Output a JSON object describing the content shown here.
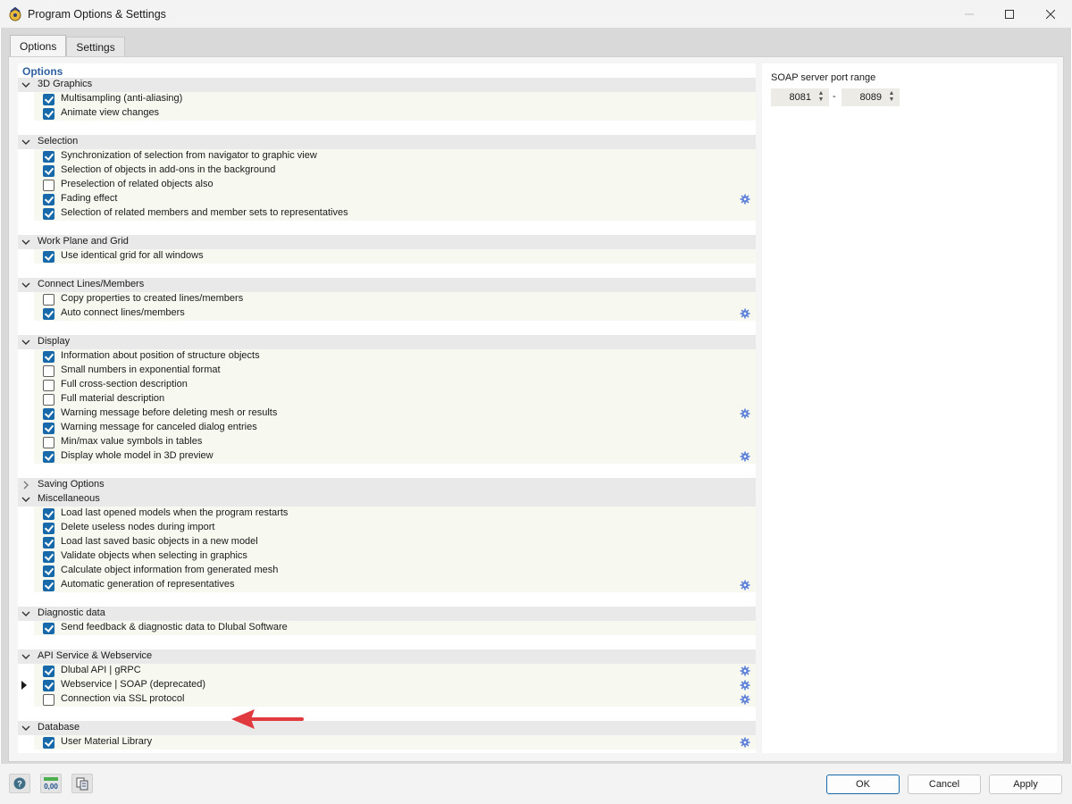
{
  "window": {
    "title": "Program Options & Settings"
  },
  "tabs": [
    {
      "label": "Options",
      "active": true
    },
    {
      "label": "Settings",
      "active": false
    }
  ],
  "options_header": "Options",
  "sections": [
    {
      "title": "3D Graphics",
      "expanded": true,
      "items": [
        {
          "label": "Multisampling (anti-aliasing)",
          "checked": true,
          "gear": false
        },
        {
          "label": "Animate view changes",
          "checked": true,
          "gear": false
        }
      ]
    },
    {
      "title": "Selection",
      "expanded": true,
      "items": [
        {
          "label": "Synchronization of selection from navigator to graphic view",
          "checked": true,
          "gear": false
        },
        {
          "label": "Selection of objects in add-ons in the background",
          "checked": true,
          "gear": false
        },
        {
          "label": "Preselection of related objects also",
          "checked": false,
          "gear": false
        },
        {
          "label": "Fading effect",
          "checked": true,
          "gear": true
        },
        {
          "label": "Selection of related members and member sets to representatives",
          "checked": true,
          "gear": false
        }
      ]
    },
    {
      "title": "Work Plane and Grid",
      "expanded": true,
      "items": [
        {
          "label": "Use identical grid for all windows",
          "checked": true,
          "gear": false
        }
      ]
    },
    {
      "title": "Connect Lines/Members",
      "expanded": true,
      "items": [
        {
          "label": "Copy properties to created lines/members",
          "checked": false,
          "gear": false
        },
        {
          "label": "Auto connect lines/members",
          "checked": true,
          "gear": true
        }
      ]
    },
    {
      "title": "Display",
      "expanded": true,
      "items": [
        {
          "label": "Information about position of structure objects",
          "checked": true,
          "gear": false
        },
        {
          "label": "Small numbers in exponential format",
          "checked": false,
          "gear": false
        },
        {
          "label": "Full cross-section description",
          "checked": false,
          "gear": false
        },
        {
          "label": "Full material description",
          "checked": false,
          "gear": false
        },
        {
          "label": "Warning message before deleting mesh or results",
          "checked": true,
          "gear": true
        },
        {
          "label": "Warning message for canceled dialog entries",
          "checked": true,
          "gear": false
        },
        {
          "label": "Min/max value symbols in tables",
          "checked": false,
          "gear": false
        },
        {
          "label": "Display whole model in 3D preview",
          "checked": true,
          "gear": true
        }
      ]
    },
    {
      "title": "Saving Options",
      "expanded": false,
      "items": []
    },
    {
      "title": "Miscellaneous",
      "expanded": true,
      "items": [
        {
          "label": "Load last opened models when the program restarts",
          "checked": true,
          "gear": false
        },
        {
          "label": "Delete useless nodes during import",
          "checked": true,
          "gear": false
        },
        {
          "label": "Load last saved basic objects in a new model",
          "checked": true,
          "gear": false
        },
        {
          "label": "Validate objects when selecting in graphics",
          "checked": true,
          "gear": false
        },
        {
          "label": "Calculate object information from generated mesh",
          "checked": true,
          "gear": false
        },
        {
          "label": "Automatic generation of representatives",
          "checked": true,
          "gear": true
        }
      ]
    },
    {
      "title": "Diagnostic data",
      "expanded": true,
      "items": [
        {
          "label": "Send feedback & diagnostic data to Dlubal Software",
          "checked": true,
          "gear": false
        }
      ]
    },
    {
      "title": "API Service & Webservice",
      "expanded": true,
      "items": [
        {
          "label": "Dlubal API | gRPC",
          "checked": true,
          "gear": true
        },
        {
          "label": "Webservice | SOAP (deprecated)",
          "checked": true,
          "gear": true,
          "current": true
        },
        {
          "label": "Connection via SSL protocol",
          "checked": false,
          "gear": true
        }
      ]
    },
    {
      "title": "Database",
      "expanded": true,
      "items": [
        {
          "label": "User Material Library",
          "checked": true,
          "gear": true
        }
      ]
    }
  ],
  "soap": {
    "label": "SOAP server port range",
    "from": "8081",
    "separator": "-",
    "to": "8089"
  },
  "footer": {
    "ok_label": "OK",
    "cancel_label": "Cancel",
    "apply_label": "Apply"
  },
  "icons": {
    "app": "dlubal-app-icon",
    "tool1": "help-icon",
    "tool2": "units-icon",
    "tool3": "copy-settings-icon",
    "gear": "gear-icon"
  },
  "colors": {
    "accent": "#1769aa",
    "arrow": "#e0393e",
    "header_text": "#2e5fa0"
  }
}
